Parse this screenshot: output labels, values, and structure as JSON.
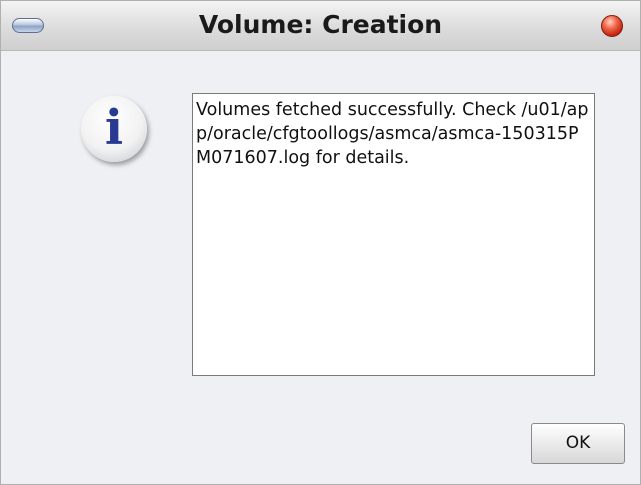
{
  "dialog": {
    "title": "Volume: Creation",
    "icon": "info-icon",
    "icon_glyph": "i",
    "message": "Volumes fetched successfully. Check /u01/app/oracle/cfgtoollogs/asmca/asmca-150315PM071607.log for details.",
    "ok_label": "OK"
  },
  "colors": {
    "title_bar": "#d8d8d8",
    "window_background": "#eef0f4",
    "close_button": "#d9351e",
    "info_icon_letter": "#283a92"
  }
}
